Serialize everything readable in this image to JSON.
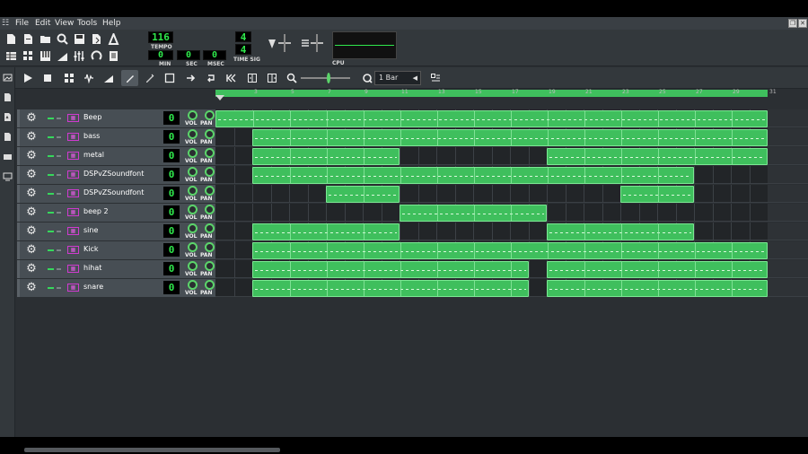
{
  "menu": {
    "items": [
      "File",
      "Edit",
      "View",
      "Tools",
      "Help"
    ]
  },
  "transport": {
    "tempo_value": "116",
    "tempo_label": "TEMPO",
    "min_value": "0",
    "min_label": "MIN",
    "sec_value": "0",
    "sec_label": "SEC",
    "msec_value": "0",
    "msec_label": "MSEC",
    "timesig_num": "4",
    "timesig_den": "4",
    "timesig_label": "TIME SIG",
    "cpu_label": "CPU"
  },
  "song_editor": {
    "snap_value": "1 Bar"
  },
  "ruler": {
    "ticks": [
      "3",
      "5",
      "7",
      "9",
      "11",
      "13",
      "15",
      "17",
      "19",
      "21",
      "23",
      "25",
      "27",
      "29",
      "31"
    ]
  },
  "tracks": [
    {
      "name": "Beep",
      "value": "0"
    },
    {
      "name": "bass",
      "value": "0"
    },
    {
      "name": "metal",
      "value": "0"
    },
    {
      "name": "DSPvZSoundfont",
      "value": "0"
    },
    {
      "name": "DSPvZSoundfont",
      "value": "0"
    },
    {
      "name": "beep 2",
      "value": "0"
    },
    {
      "name": "sine",
      "value": "0"
    },
    {
      "name": "Kick",
      "value": "0"
    },
    {
      "name": "hihat",
      "value": "0"
    },
    {
      "name": "snare",
      "value": "0"
    }
  ],
  "knob_labels": {
    "vol": "VOL",
    "pan": "PAN"
  },
  "clips": [
    [
      [
        0,
        30
      ]
    ],
    [
      [
        2,
        30
      ]
    ],
    [
      [
        2,
        10
      ],
      [
        18,
        30
      ]
    ],
    [
      [
        2,
        26
      ]
    ],
    [
      [
        6,
        10
      ],
      [
        22,
        26
      ]
    ],
    [
      [
        10,
        18
      ]
    ],
    [
      [
        2,
        10
      ],
      [
        18,
        26
      ]
    ],
    [
      [
        2,
        30
      ]
    ],
    [
      [
        2,
        17
      ],
      [
        18,
        30
      ]
    ],
    [
      [
        2,
        17
      ],
      [
        18,
        30
      ]
    ]
  ],
  "colors": {
    "clip": "#3fbf5d",
    "lcd_text": "#2fe84c",
    "instrument": "#d03ad0"
  }
}
